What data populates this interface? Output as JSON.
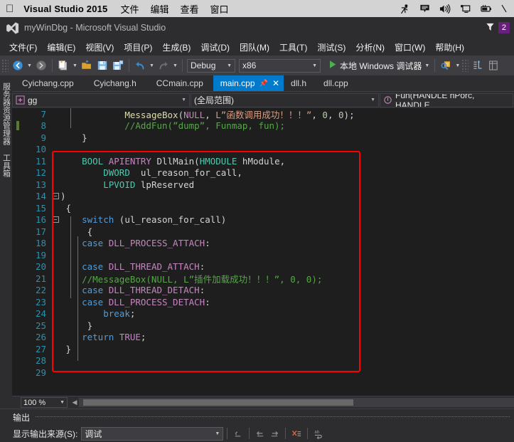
{
  "macbar": {
    "apple_icon": "apple-icon",
    "app_name": "Visual Studio 2015",
    "menus": [
      "文件",
      "编辑",
      "查看",
      "窗口"
    ],
    "tray_icons": [
      "accessibility-icon",
      "notification-icon",
      "volume-icon",
      "display-icon",
      "battery-icon"
    ]
  },
  "titlebar": {
    "logo_icon": "visual-studio-logo-icon",
    "title": "myWinDbg - Microsoft Visual Studio",
    "feedback_icon": "feedback-funnel-icon",
    "badge": "2"
  },
  "menubar": {
    "items": [
      "文件(F)",
      "编辑(E)",
      "视图(V)",
      "项目(P)",
      "生成(B)",
      "调试(D)",
      "团队(M)",
      "工具(T)",
      "测试(S)",
      "分析(N)",
      "窗口(W)",
      "帮助(H)"
    ]
  },
  "toolbar": {
    "nav_back_icon": "navigate-back-icon",
    "nav_forward_icon": "navigate-forward-icon",
    "new_item_icon": "new-item-icon",
    "open_file_icon": "open-file-icon",
    "save_icon": "save-icon",
    "save_all_icon": "save-all-icon",
    "undo_icon": "undo-icon",
    "redo_icon": "redo-icon",
    "config_value": "Debug",
    "platform_value": "x86",
    "run_icon": "run-play-icon",
    "run_label": "本地 Windows 调试器",
    "find_icon": "find-in-files-icon",
    "solution_explorer_icon": "solution-explorer-icon",
    "properties_icon": "properties-window-icon"
  },
  "leftrail": {
    "tabs": [
      "服务器资源管理器",
      "工具箱"
    ]
  },
  "tabs": {
    "items": [
      {
        "label": "Cyichang.cpp",
        "active": false
      },
      {
        "label": "Cyichang.h",
        "active": false
      },
      {
        "label": "CCmain.cpp",
        "active": false
      },
      {
        "label": "main.cpp",
        "active": true
      },
      {
        "label": "dll.h",
        "active": false
      },
      {
        "label": "dll.cpp",
        "active": false
      }
    ],
    "pin_icon": "pin-icon",
    "close_icon": "close-icon"
  },
  "navbar": {
    "project_icon": "project-icon",
    "project": "gg",
    "scope": "(全局范围)",
    "member_icon": "method-icon",
    "member": "Fun(HANDLE hPorc, HANDLE",
    "dropdown_icon": "chevron-down-icon"
  },
  "editor": {
    "first_line": 7,
    "lines": [
      {
        "n": 7,
        "fold": "",
        "bp": false,
        "tokens": [
          {
            "t": "            ",
            "c": "id"
          },
          {
            "t": "MessageBox",
            "c": "fn"
          },
          {
            "t": "(",
            "c": "id"
          },
          {
            "t": "NULL",
            "c": "mac"
          },
          {
            "t": ", ",
            "c": "id"
          },
          {
            "t": "L”函数调用成功！！！”",
            "c": "str"
          },
          {
            "t": ", ",
            "c": "id"
          },
          {
            "t": "0",
            "c": "num"
          },
          {
            "t": ", ",
            "c": "id"
          },
          {
            "t": "0",
            "c": "num"
          },
          {
            "t": ");",
            "c": "id"
          }
        ]
      },
      {
        "n": 8,
        "fold": "",
        "bp": true,
        "tokens": [
          {
            "t": "            //AddFun(”dump”, Funmap, fun);",
            "c": "cmt"
          }
        ]
      },
      {
        "n": 9,
        "fold": "",
        "bp": false,
        "tokens": [
          {
            "t": "    }",
            "c": "id"
          }
        ]
      },
      {
        "n": 10,
        "fold": "",
        "bp": false,
        "tokens": []
      },
      {
        "n": 11,
        "fold": "",
        "bp": false,
        "tokens": [
          {
            "t": "    ",
            "c": "id"
          },
          {
            "t": "BOOL",
            "c": "kc"
          },
          {
            "t": " ",
            "c": "id"
          },
          {
            "t": "APIENTRY",
            "c": "mac"
          },
          {
            "t": " DllMain(",
            "c": "id"
          },
          {
            "t": "HMODULE",
            "c": "kc"
          },
          {
            "t": " hModule,",
            "c": "id"
          }
        ]
      },
      {
        "n": 12,
        "fold": "",
        "bp": false,
        "tokens": [
          {
            "t": "        ",
            "c": "id"
          },
          {
            "t": "DWORD",
            "c": "kc"
          },
          {
            "t": "  ul_reason_for_call,",
            "c": "id"
          }
        ]
      },
      {
        "n": 13,
        "fold": "",
        "bp": false,
        "tokens": [
          {
            "t": "        ",
            "c": "id"
          },
          {
            "t": "LPVOID",
            "c": "kc"
          },
          {
            "t": " lpReserved",
            "c": "id"
          }
        ]
      },
      {
        "n": 14,
        "fold": "minus",
        "bp": false,
        "tokens": [
          {
            "t": ")",
            "c": "id"
          }
        ]
      },
      {
        "n": 15,
        "fold": "",
        "bp": false,
        "tokens": [
          {
            "t": " {",
            "c": "id"
          }
        ]
      },
      {
        "n": 16,
        "fold": "minus",
        "bp": false,
        "tokens": [
          {
            "t": "    ",
            "c": "id"
          },
          {
            "t": "switch",
            "c": "k"
          },
          {
            "t": " (ul_reason_for_call)",
            "c": "id"
          }
        ]
      },
      {
        "n": 17,
        "fold": "",
        "bp": false,
        "tokens": [
          {
            "t": "     {",
            "c": "id"
          }
        ]
      },
      {
        "n": 18,
        "fold": "",
        "bp": false,
        "tokens": [
          {
            "t": "    ",
            "c": "id"
          },
          {
            "t": "case",
            "c": "k"
          },
          {
            "t": " ",
            "c": "id"
          },
          {
            "t": "DLL_PROCESS_ATTACH",
            "c": "mac"
          },
          {
            "t": ":",
            "c": "id"
          }
        ]
      },
      {
        "n": 19,
        "fold": "",
        "bp": false,
        "tokens": []
      },
      {
        "n": 20,
        "fold": "",
        "bp": false,
        "tokens": [
          {
            "t": "    ",
            "c": "id"
          },
          {
            "t": "case",
            "c": "k"
          },
          {
            "t": " ",
            "c": "id"
          },
          {
            "t": "DLL_THREAD_ATTACH",
            "c": "mac"
          },
          {
            "t": ":",
            "c": "id"
          }
        ]
      },
      {
        "n": 21,
        "fold": "",
        "bp": false,
        "tokens": [
          {
            "t": "    //MessageBox(NULL, L”插件加载成功！！！”, 0, 0);",
            "c": "cmt"
          }
        ]
      },
      {
        "n": 22,
        "fold": "",
        "bp": false,
        "tokens": [
          {
            "t": "    ",
            "c": "id"
          },
          {
            "t": "case",
            "c": "k"
          },
          {
            "t": " ",
            "c": "id"
          },
          {
            "t": "DLL_THREAD_DETACH",
            "c": "mac"
          },
          {
            "t": ":",
            "c": "id"
          }
        ]
      },
      {
        "n": 23,
        "fold": "",
        "bp": false,
        "tokens": [
          {
            "t": "    ",
            "c": "id"
          },
          {
            "t": "case",
            "c": "k"
          },
          {
            "t": " ",
            "c": "id"
          },
          {
            "t": "DLL_PROCESS_DETACH",
            "c": "mac"
          },
          {
            "t": ":",
            "c": "id"
          }
        ]
      },
      {
        "n": 24,
        "fold": "",
        "bp": false,
        "tokens": [
          {
            "t": "        ",
            "c": "id"
          },
          {
            "t": "break",
            "c": "k"
          },
          {
            "t": ";",
            "c": "id"
          }
        ]
      },
      {
        "n": 25,
        "fold": "",
        "bp": false,
        "tokens": [
          {
            "t": "     }",
            "c": "id"
          }
        ]
      },
      {
        "n": 26,
        "fold": "",
        "bp": false,
        "tokens": [
          {
            "t": "    ",
            "c": "id"
          },
          {
            "t": "return",
            "c": "k"
          },
          {
            "t": " ",
            "c": "id"
          },
          {
            "t": "TRUE",
            "c": "mac"
          },
          {
            "t": ";",
            "c": "id"
          }
        ]
      },
      {
        "n": 27,
        "fold": "",
        "bp": false,
        "tokens": [
          {
            "t": " }",
            "c": "id"
          }
        ]
      },
      {
        "n": 28,
        "fold": "",
        "bp": false,
        "tokens": []
      },
      {
        "n": 29,
        "fold": "",
        "bp": false,
        "tokens": []
      }
    ],
    "annotation_color": "#ff0000"
  },
  "statusrow": {
    "zoom": "100 %",
    "zoom_arrow_icon": "chevron-down-icon",
    "scroll_left_icon": "scroll-left-icon"
  },
  "output": {
    "title": "输出",
    "source_label": "显示输出来源(S):",
    "source_value": "调试",
    "source_arrow_icon": "chevron-down-icon",
    "tool_icons": [
      "clear-all-icon",
      "go-to-previous-icon",
      "go-to-next-icon",
      "cancel-search-icon",
      "word-wrap-icon"
    ]
  },
  "colors": {
    "accent": "#007acc",
    "badge": "#68217a",
    "annotation": "#ff0000",
    "editor_bg": "#1e1e1e",
    "chrome_bg": "#2d2d30"
  }
}
